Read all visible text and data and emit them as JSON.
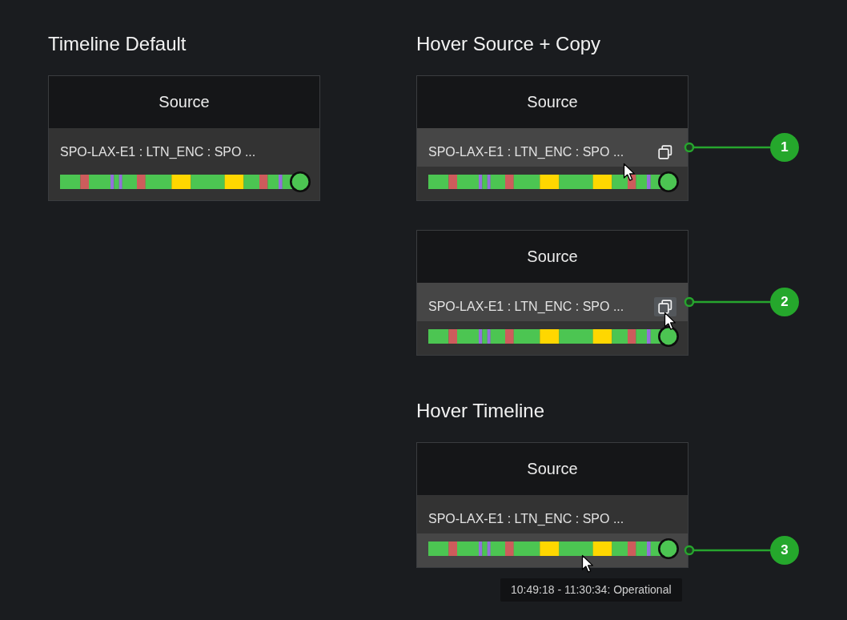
{
  "columns": [
    {
      "sections": [
        {
          "title": "Timeline Default",
          "cards": [
            {
              "header": "Source",
              "source_name": "SPO-LAX-E1 : LTN_ENC : SPO ...",
              "source_hovered": false,
              "copy_hovered": false,
              "timeline_hovered": false
            }
          ]
        }
      ]
    },
    {
      "sections": [
        {
          "title": "Hover Source + Copy",
          "cards": [
            {
              "header": "Source",
              "source_name": "SPO-LAX-E1 : LTN_ENC : SPO ...",
              "source_hovered": true,
              "copy_hovered": false,
              "timeline_hovered": false,
              "callout": "1"
            },
            {
              "header": "Source",
              "source_name": "SPO-LAX-E1 : LTN_ENC : SPO ...",
              "source_hovered": true,
              "copy_hovered": true,
              "timeline_hovered": false,
              "callout": "2"
            }
          ]
        },
        {
          "title": "Hover Timeline",
          "cards": [
            {
              "header": "Source",
              "source_name": "SPO-LAX-E1 : LTN_ENC : SPO ...",
              "source_hovered": false,
              "copy_hovered": false,
              "timeline_hovered": true,
              "callout": "3",
              "tooltip": "10:49:18 - 11:30:34: Operational"
            }
          ]
        }
      ]
    }
  ]
}
